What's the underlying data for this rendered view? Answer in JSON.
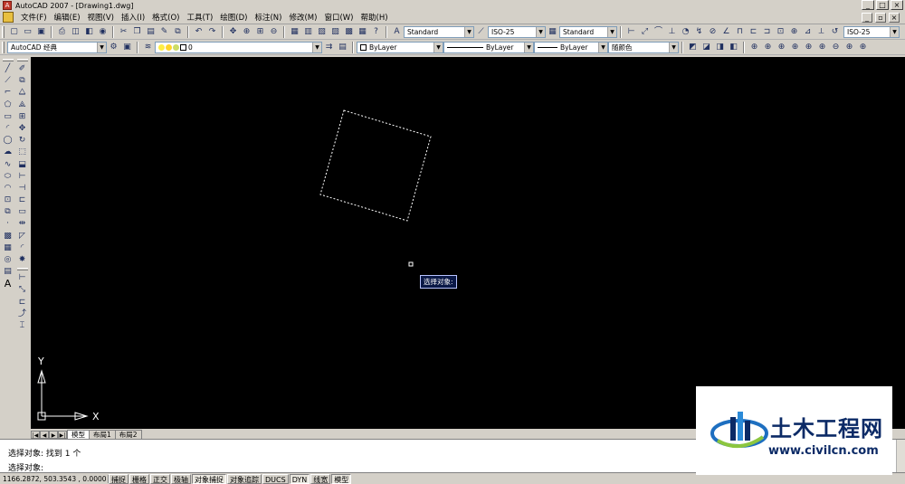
{
  "window": {
    "title": "AutoCAD 2007 - [Drawing1.dwg]",
    "controls": [
      "_",
      "□",
      "×"
    ]
  },
  "menu": {
    "items": [
      "文件(F)",
      "编辑(E)",
      "视图(V)",
      "插入(I)",
      "格式(O)",
      "工具(T)",
      "绘图(D)",
      "标注(N)",
      "修改(M)",
      "窗口(W)",
      "帮助(H)"
    ],
    "doc_controls": [
      "_",
      "▫",
      "×"
    ]
  },
  "toolbar_styles": {
    "text_style": "Standard",
    "dim_style": "ISO-25",
    "table_style": "Standard",
    "dim_style_right": "ISO-25"
  },
  "toolbar_layers": {
    "workspace": "AutoCAD 经典",
    "layer": "0",
    "color": "ByLayer",
    "linetype": "ByLayer",
    "lineweight": "ByLayer",
    "plot_style": "随颜色"
  },
  "canvas": {
    "background": "#000000",
    "tooltip": "选择对象:",
    "ucs_y": "Y",
    "ucs_x": "X"
  },
  "tabs": {
    "nav": [
      "|◀",
      "◀",
      "▶",
      "▶|"
    ],
    "items": [
      "模型",
      "布局1",
      "布局2"
    ],
    "active": "模型"
  },
  "command": {
    "line1": "选择对象: 找到 1 个",
    "line2": "选择对象:"
  },
  "status": {
    "coords": "1166.2872, 503.3543 , 0.0000",
    "buttons": [
      {
        "label": "捕捉",
        "on": false
      },
      {
        "label": "栅格",
        "on": false
      },
      {
        "label": "正交",
        "on": false
      },
      {
        "label": "极轴",
        "on": false
      },
      {
        "label": "对象捕捉",
        "on": true
      },
      {
        "label": "对象追踪",
        "on": false
      },
      {
        "label": "DUCS",
        "on": false
      },
      {
        "label": "DYN",
        "on": true
      },
      {
        "label": "线宽",
        "on": false
      },
      {
        "label": "模型",
        "on": true
      }
    ]
  },
  "watermark": {
    "name": "土木工程网",
    "url": "www.civilcn.com"
  }
}
